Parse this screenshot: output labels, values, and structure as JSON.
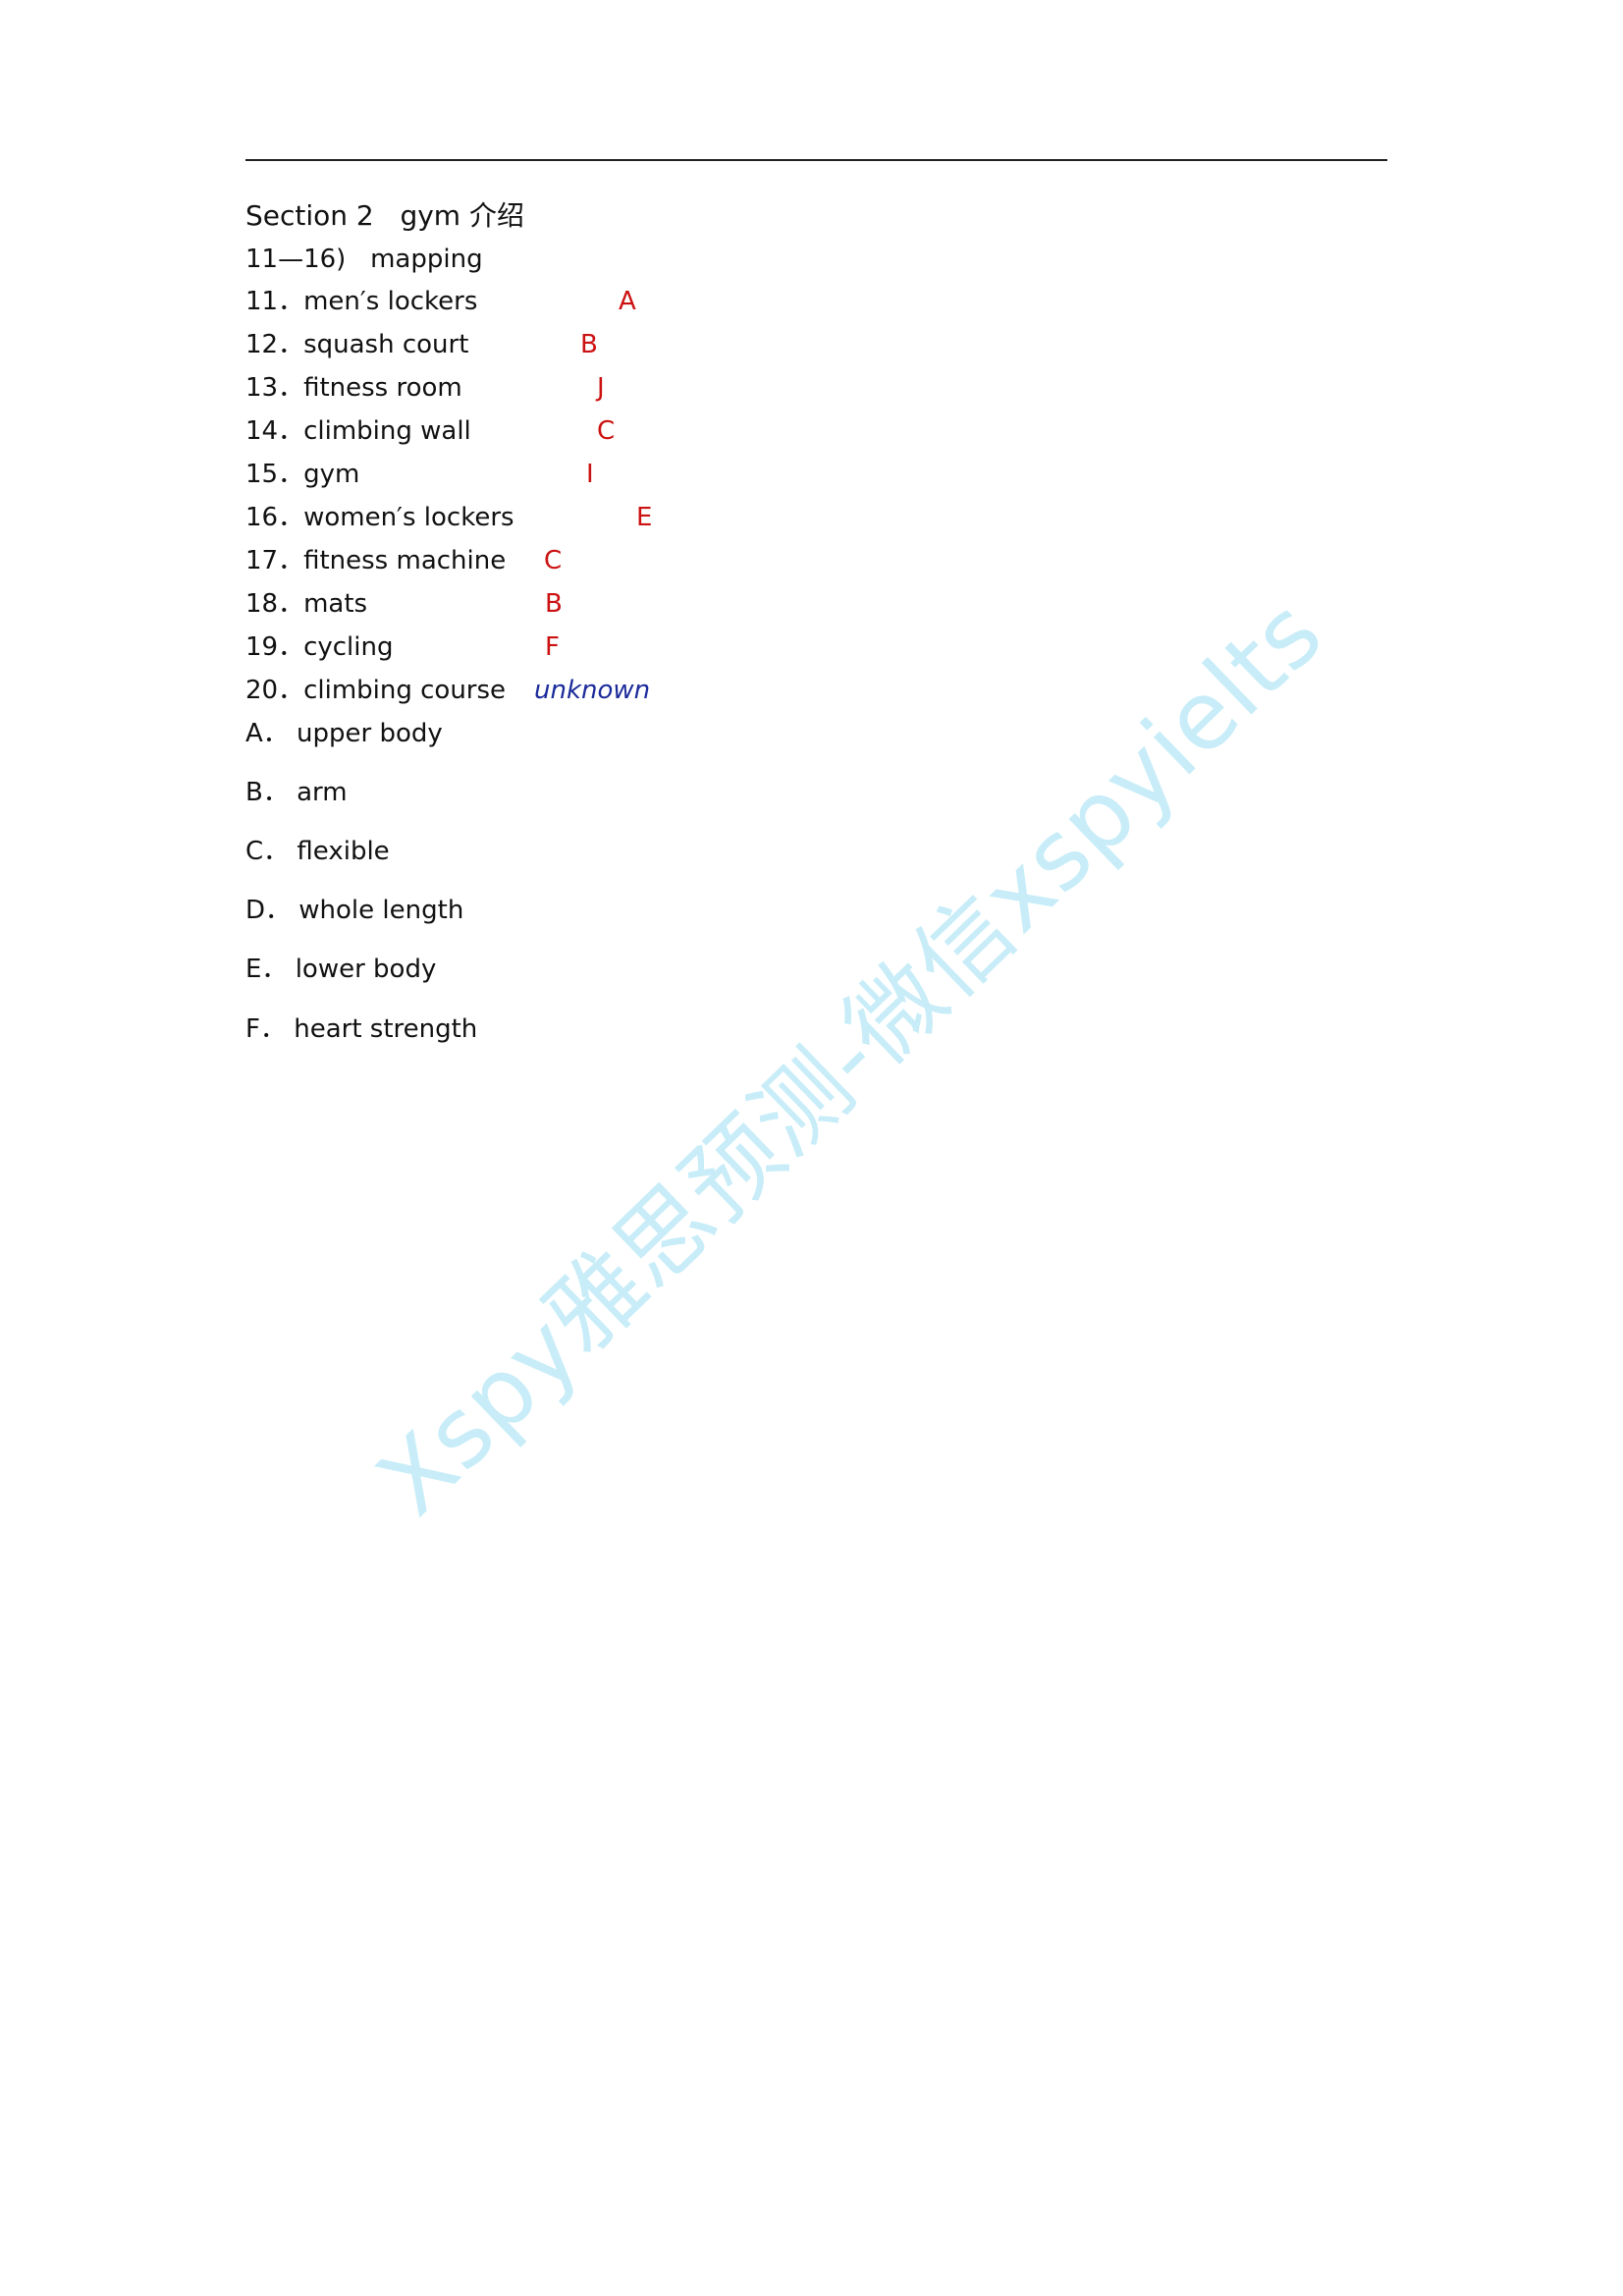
{
  "heading": "Section 2   gym 介绍",
  "subheading": "11—16)   mapping",
  "questions": [
    {
      "label": "11．men′s lockers",
      "answer": "A"
    },
    {
      "label": "12．squash court",
      "answer": "B"
    },
    {
      "label": "13．fitness room",
      "answer": "J"
    },
    {
      "label": "14．climbing wall",
      "answer": "C"
    },
    {
      "label": "15．gym",
      "answer": "I"
    },
    {
      "label": "16．women′s lockers",
      "answer": "E"
    },
    {
      "label": "17．fitness machine",
      "answer": "C"
    },
    {
      "label": "18．mats",
      "answer": "B"
    },
    {
      "label": "19．cycling",
      "answer": "F"
    },
    {
      "label": "20．climbing course",
      "answer": "unknown"
    }
  ],
  "options": [
    "A． upper body",
    "B． arm",
    "C． flexible",
    "D． whole length",
    "E． lower body",
    "F． heart strength"
  ],
  "watermark": "Xspy雅思预测-微信xspyielts",
  "colors": {
    "answer": "#cc1111",
    "unknown_answer": "#1a2a9a",
    "watermark": "#bfeaf7"
  }
}
